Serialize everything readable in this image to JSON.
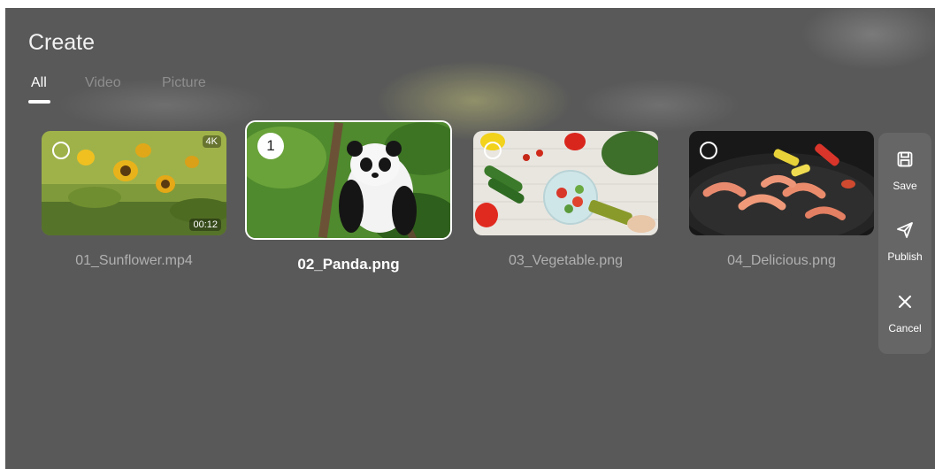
{
  "header": {
    "title": "Create"
  },
  "tabs": [
    {
      "label": "All",
      "active": true
    },
    {
      "label": "Video",
      "active": false
    },
    {
      "label": "Picture",
      "active": false
    }
  ],
  "media": [
    {
      "caption": "01_Sunflower.mp4",
      "type": "video",
      "quality_badge": "4K",
      "duration": "00:12",
      "selected": false,
      "selection_index": ""
    },
    {
      "caption": "02_Panda.png",
      "type": "image",
      "selected": true,
      "selection_index": "1"
    },
    {
      "caption": "03_Vegetable.png",
      "type": "image",
      "selected": false,
      "selection_index": ""
    },
    {
      "caption": "04_Delicious.png",
      "type": "image",
      "selected": false,
      "selection_index": ""
    }
  ],
  "side_actions": [
    {
      "label": "Save",
      "icon": "save-icon"
    },
    {
      "label": "Publish",
      "icon": "send-icon"
    },
    {
      "label": "Cancel",
      "icon": "close-icon"
    }
  ],
  "colors": {
    "background": "#595959",
    "panel": "#666666",
    "text_primary": "#ffffff",
    "text_muted": "#8e8e8e"
  }
}
